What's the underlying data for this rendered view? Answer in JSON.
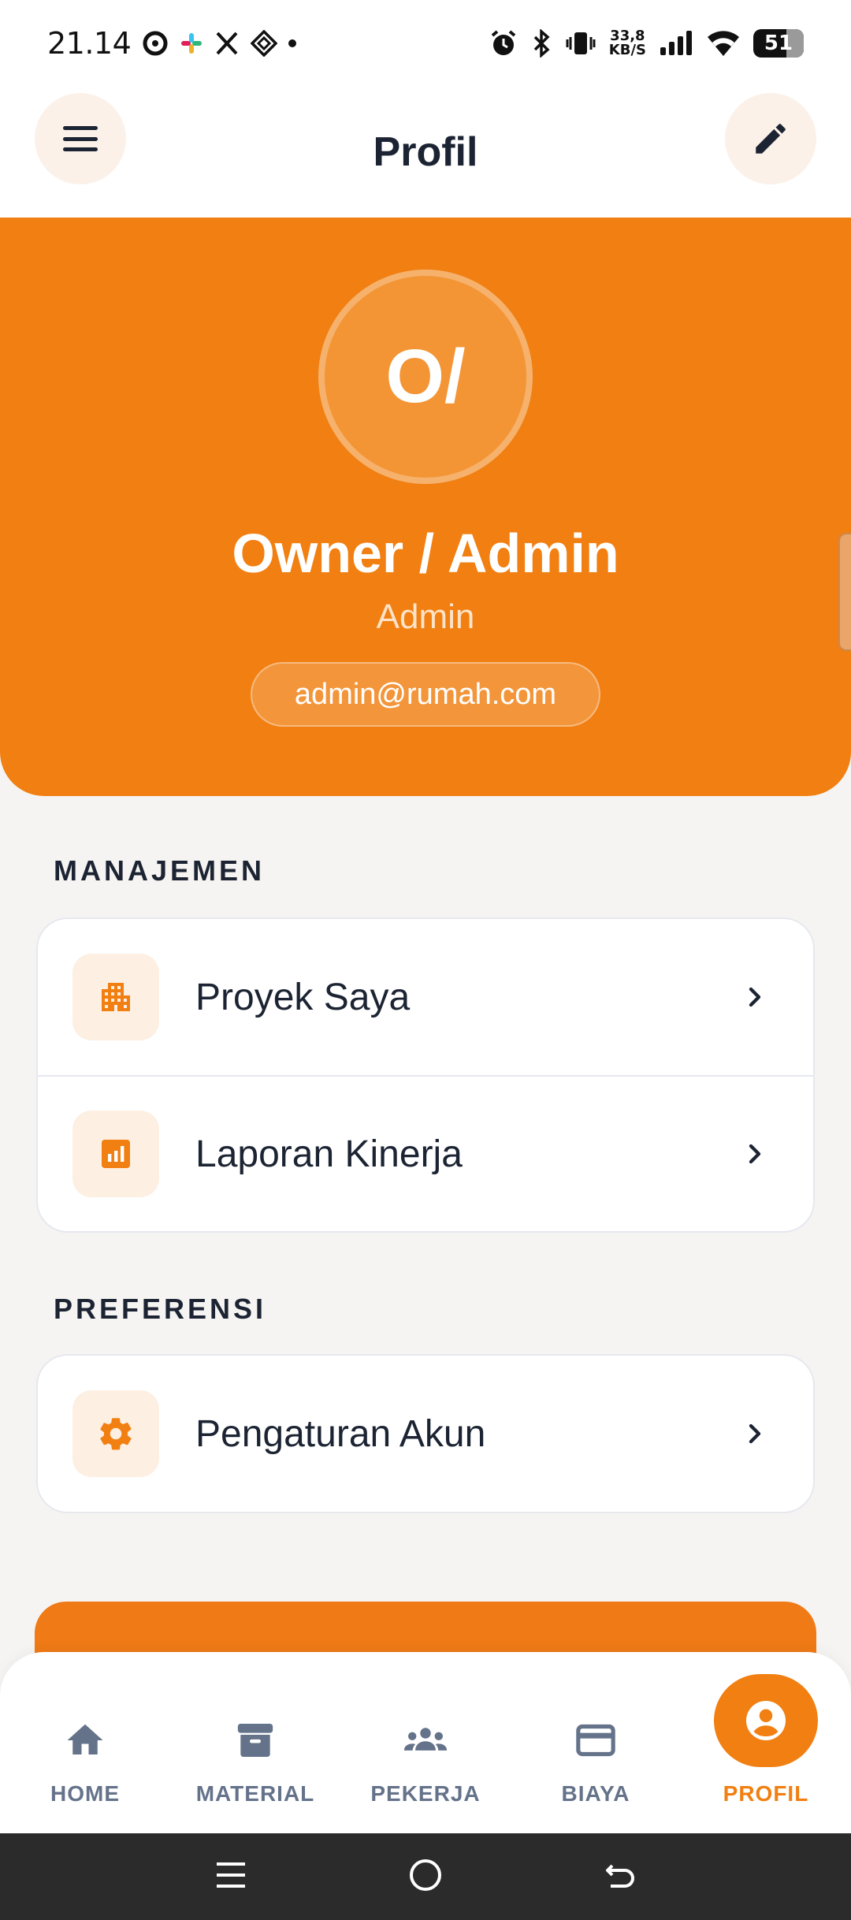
{
  "status_bar": {
    "time": "21.14",
    "net_speed_value": "33,8",
    "net_speed_unit": "KB/S",
    "battery": "51"
  },
  "app_bar": {
    "title": "Profil"
  },
  "profile": {
    "initials": "O/",
    "name": "Owner / Admin",
    "role": "Admin",
    "email": "admin@rumah.com"
  },
  "sections": {
    "management": {
      "title": "MANAJEMEN",
      "items": [
        {
          "label": "Proyek Saya",
          "icon": "building-icon"
        },
        {
          "label": "Laporan Kinerja",
          "icon": "bar-chart-icon"
        }
      ]
    },
    "preferences": {
      "title": "PREFERENSI",
      "items": [
        {
          "label": "Pengaturan Akun",
          "icon": "gear-icon"
        }
      ]
    }
  },
  "bottom_nav": {
    "items": [
      {
        "label": "HOME",
        "icon": "home-icon"
      },
      {
        "label": "MATERIAL",
        "icon": "archive-box-icon"
      },
      {
        "label": "PEKERJA",
        "icon": "group-icon"
      },
      {
        "label": "BIAYA",
        "icon": "credit-card-icon"
      },
      {
        "label": "PROFIL",
        "icon": "account-circle-icon"
      }
    ],
    "active_index": 4
  },
  "colors": {
    "accent": "#f17f11",
    "text_dark": "#1c2433",
    "nav_inactive": "#64728a",
    "background": "#f6f4f2"
  }
}
